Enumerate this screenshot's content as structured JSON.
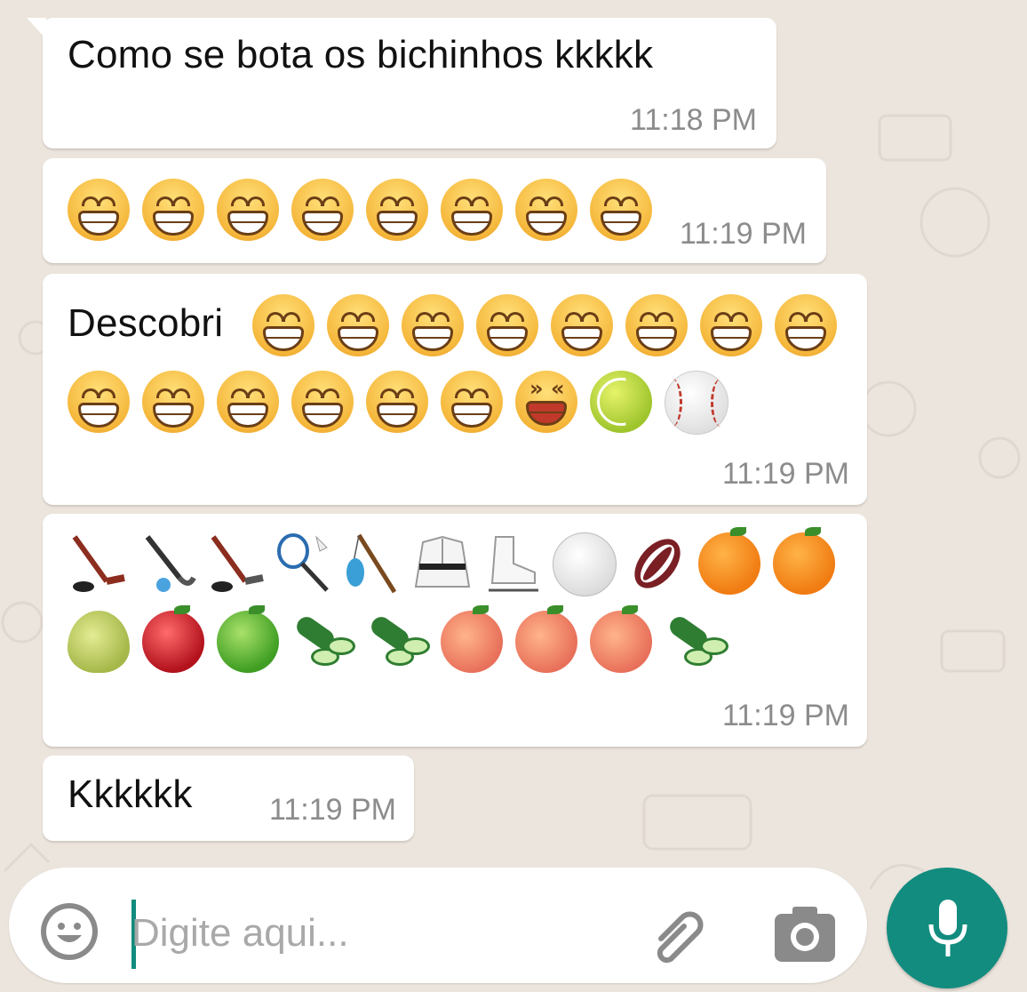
{
  "messages": [
    {
      "text": "Como se bota os bichinhos kkkkk",
      "time": "11:18 PM"
    },
    {
      "text": "",
      "emojis": [
        "grinning-face",
        "grinning-face",
        "grinning-face",
        "grinning-face",
        "grinning-face",
        "grinning-face",
        "grinning-face",
        "grinning-face"
      ],
      "time": "11:19 PM"
    },
    {
      "text": "Descobri",
      "emojis_row1": [
        "grinning-face",
        "grinning-face",
        "grinning-face",
        "grinning-face",
        "grinning-face",
        "grinning-face",
        "grinning-face",
        "grinning-face"
      ],
      "emojis_row2": [
        "grinning-face",
        "grinning-face",
        "grinning-face",
        "grinning-face",
        "grinning-face",
        "grinning-face",
        "laughing-face",
        "tennis-ball",
        "baseball"
      ],
      "time": "11:19 PM"
    },
    {
      "text": "",
      "emojis_row1": [
        "ice-hockey",
        "field-hockey",
        "ice-hockey",
        "badminton",
        "fishing-pole",
        "martial-arts-uniform",
        "ice-skate",
        "volleyball",
        "rugby-football",
        "orange",
        "orange"
      ],
      "emojis_row2": [
        "pear",
        "red-apple",
        "green-apple",
        "cucumber",
        "cucumber",
        "peach",
        "peach",
        "peach",
        "cucumber"
      ],
      "time": "11:19 PM"
    },
    {
      "text": "Kkkkkk",
      "time": "11:19 PM"
    }
  ],
  "input": {
    "placeholder": "Digite aqui..."
  },
  "icons": [
    "emoji-icon",
    "attach-icon",
    "camera-icon",
    "mic-icon"
  ],
  "colors": {
    "background": "#ece5dd",
    "bubble": "#ffffff",
    "accent": "#128c7e",
    "time": "#8c8c8c"
  }
}
